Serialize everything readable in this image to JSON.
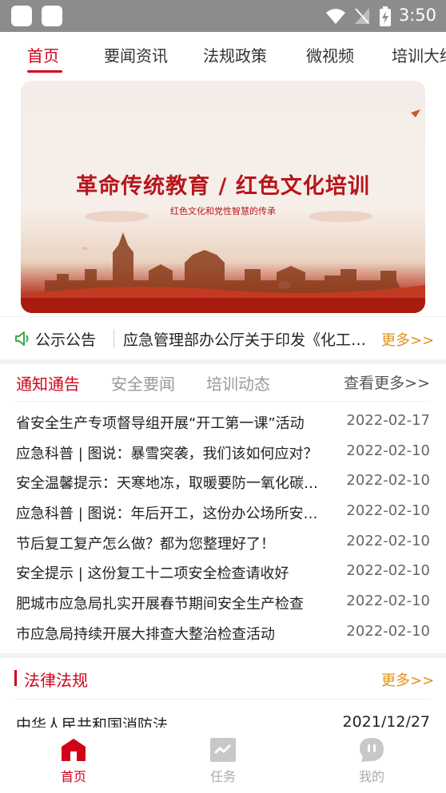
{
  "status_bar": {
    "time": "3:50"
  },
  "top_nav": {
    "tabs": [
      {
        "label": "首页",
        "active": true
      },
      {
        "label": "要闻资讯",
        "active": false
      },
      {
        "label": "法规政策",
        "active": false
      },
      {
        "label": "微视频",
        "active": false
      },
      {
        "label": "培训大纲",
        "active": false
      }
    ]
  },
  "banner": {
    "title": "革命传统教育 / 红色文化培训",
    "subtitle": "红色文化和党性智慧的传承"
  },
  "notice": {
    "label": "公示公告",
    "text": "应急管理部办公厅关于印发《化工园区安全整治提升工作方案》的通知",
    "more": "更多>>"
  },
  "news": {
    "tabs": [
      {
        "label": "通知通告",
        "active": true
      },
      {
        "label": "安全要闻",
        "active": false
      },
      {
        "label": "培训动态",
        "active": false
      }
    ],
    "more": "查看更多>>",
    "items": [
      {
        "title": "省安全生产专项督导组开展“开工第一课”活动",
        "date": "2022-02-17"
      },
      {
        "title": "应急科普 | 图说：暴雪突袭，我们该如何应对？",
        "date": "2022-02-10"
      },
      {
        "title": "安全温馨提示：天寒地冻，取暖要防一氧化碳中毒",
        "date": "2022-02-10"
      },
      {
        "title": "应急科普 | 图说：年后开工，这份办公场所安全提示请收好",
        "date": "2022-02-10"
      },
      {
        "title": "节后复工复产怎么做？都为您整理好了！",
        "date": "2022-02-10"
      },
      {
        "title": "安全提示 | 这份复工十二项安全检查请收好",
        "date": "2022-02-10"
      },
      {
        "title": "肥城市应急局扎实开展春节期间安全生产检查",
        "date": "2022-02-10"
      },
      {
        "title": "市应急局持续开展大排查大整治检查活动",
        "date": "2022-02-10"
      }
    ]
  },
  "laws": {
    "title": "法律法规",
    "more": "更多>>",
    "items": [
      {
        "title": "中华人民共和国消防法",
        "date": "2021/12/27"
      }
    ]
  },
  "bottom_tabs": [
    {
      "label": "首页",
      "icon": "home-icon",
      "active": true
    },
    {
      "label": "任务",
      "icon": "task-icon",
      "active": false
    },
    {
      "label": "我的",
      "icon": "profile-icon",
      "active": false
    }
  ],
  "colors": {
    "accent": "#d0021b",
    "more": "#e0901a",
    "status_bar": "#8c8c8c"
  }
}
